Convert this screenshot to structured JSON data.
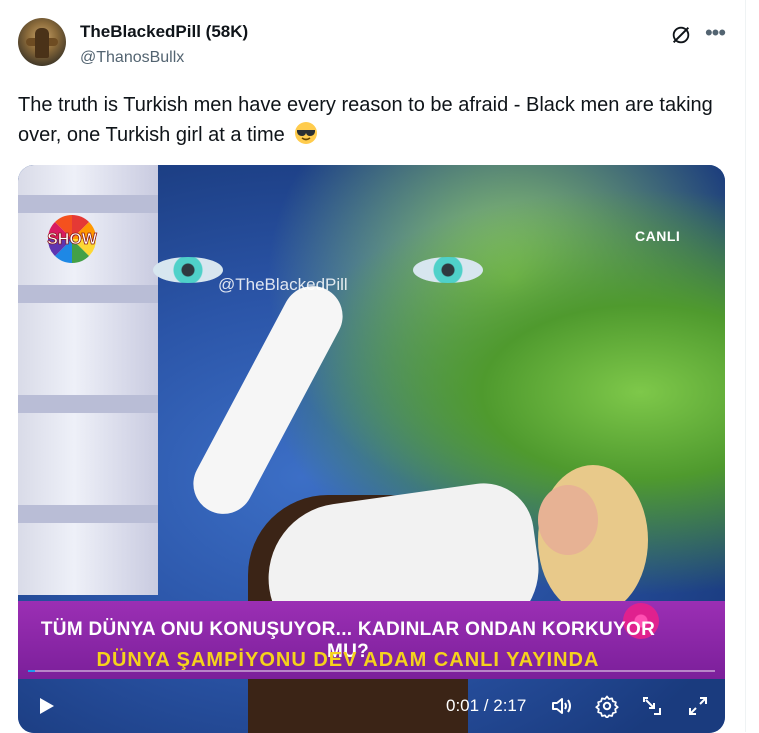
{
  "author": {
    "display_name": "TheBlackedPill (58K)",
    "handle": "@ThanosBullx"
  },
  "tweet": {
    "text": "The truth is Turkish men have every reason to be afraid - Black men are taking over, one Turkish girl at a time",
    "emoji": "smiling-face-with-sunglasses"
  },
  "video": {
    "channel_logo": "SHOW",
    "live_badge": "CANLI",
    "watermark": "@TheBlackedPill",
    "ticker_line1": "TÜM DÜNYA ONU KONUŞUYOR... KADINLAR ONDAN KORKUYOR MU?",
    "ticker_line2": "DÜNYA ŞAMPİYONU DEV ADAM CANLI YAYINDA",
    "time_display": "0:01 / 2:17",
    "progress": 0.008,
    "accent_color": "#1d9bf0"
  },
  "icons": {
    "grok": "grok-icon",
    "more": "more-icon",
    "play": "play-icon",
    "volume": "volume-icon",
    "settings": "settings-icon",
    "pip": "picture-in-picture-icon",
    "fullscreen": "fullscreen-icon"
  }
}
